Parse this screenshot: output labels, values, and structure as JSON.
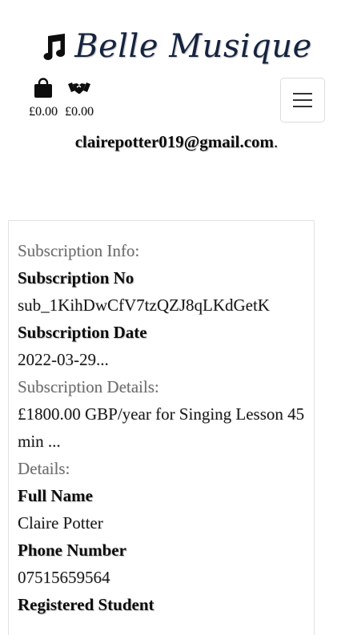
{
  "brand": {
    "name": "Belle Musique",
    "logo_icon": "music-note-icon"
  },
  "header": {
    "bag_icon": "shopping-bag-icon",
    "bag_total": "£0.00",
    "lessons_icon": "handshake-icon",
    "lessons_total": "£0.00",
    "menu_icon": "hamburger-menu-icon"
  },
  "user": {
    "email": "clairepotter019@gmail.com",
    "email_suffix": "."
  },
  "subscription": {
    "section_title": "Subscription Info:",
    "number_label": "Subscription No",
    "number_value": "sub_1KihDwCfV7tzQZJ8qLKdGetK",
    "date_label": "Subscription Date",
    "date_value": "2022-03-29...",
    "details_title": "Subscription Details:",
    "details_value": "£1800.00 GBP/year for Singing Lesson 45 min ..."
  },
  "details": {
    "section_title": "Details:",
    "full_name_label": "Full Name",
    "full_name_value": "Claire Potter",
    "phone_label": "Phone Number",
    "phone_value": "07515659564",
    "registered_label": "Registered Student"
  },
  "colors": {
    "brand": "#15233f",
    "muted_text": "#6f6f6f",
    "border": "#e2e2e2"
  }
}
